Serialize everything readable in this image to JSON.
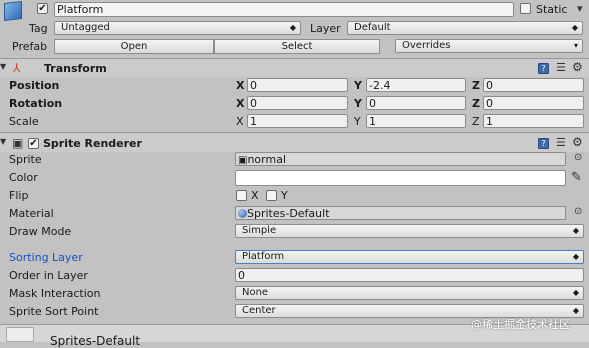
{
  "object": {
    "name": "Platform",
    "static_label": "Static",
    "tag_label": "Tag",
    "tag_value": "Untagged",
    "layer_label": "Layer",
    "layer_value": "Default",
    "prefab_label": "Prefab",
    "prefab_open": "Open",
    "prefab_select": "Select",
    "prefab_overrides": "Overrides"
  },
  "transform": {
    "title": "Transform",
    "position_label": "Position",
    "rotation_label": "Rotation",
    "scale_label": "Scale",
    "position": {
      "x": "0",
      "y": "-2.4",
      "z": "0"
    },
    "rotation": {
      "x": "0",
      "y": "0",
      "z": "0"
    },
    "scale": {
      "x": "1",
      "y": "1",
      "z": "1"
    },
    "axis": {
      "x": "X",
      "y": "Y",
      "z": "Z"
    }
  },
  "sprite_renderer": {
    "title": "Sprite Renderer",
    "sprite_label": "Sprite",
    "sprite_value": "normal",
    "color_label": "Color",
    "color_value": "#ffffff",
    "flip_label": "Flip",
    "flip_x": "X",
    "flip_y": "Y",
    "material_label": "Material",
    "material_value": "Sprites-Default",
    "draw_mode_label": "Draw Mode",
    "draw_mode_value": "Simple",
    "sorting_layer_label": "Sorting Layer",
    "sorting_layer_value": "Platform",
    "order_label": "Order in Layer",
    "order_value": "0",
    "mask_label": "Mask Interaction",
    "mask_value": "None",
    "sort_point_label": "Sprite Sort Point",
    "sort_point_value": "Center"
  },
  "footer": {
    "material_title": "Sprites-Default",
    "watermark": "@稀土掘金技术社区"
  },
  "icons": {
    "help": "?",
    "dropdown": "▾",
    "gear": "⚙",
    "sliders": "☰",
    "foldout": "▼",
    "picker": "⊙",
    "eyedropper": "✎"
  }
}
